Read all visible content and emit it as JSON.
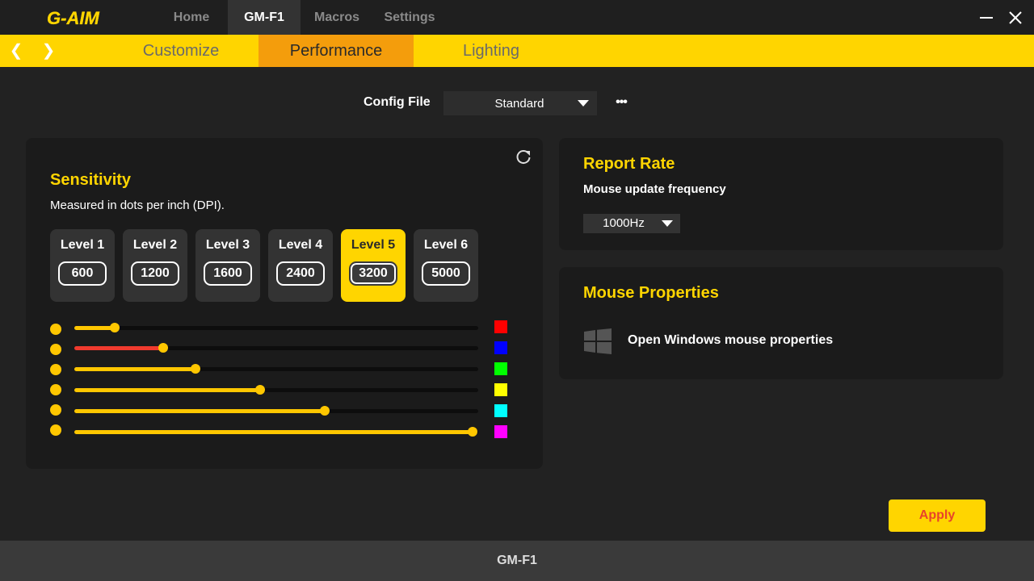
{
  "app": {
    "logo_text": "G-AIM"
  },
  "nav": {
    "tabs": [
      {
        "label": "Home",
        "active": false
      },
      {
        "label": "GM-F1",
        "active": true
      },
      {
        "label": "Macros",
        "active": false
      },
      {
        "label": "Settings",
        "active": false
      }
    ]
  },
  "window_controls": {
    "minimize_icon": "minimize-icon",
    "close_icon": "close-icon"
  },
  "subnav": {
    "back_icon": "chevron-left-icon",
    "forward_icon": "chevron-right-icon",
    "tabs": [
      {
        "label": "Customize",
        "active": false
      },
      {
        "label": "Performance",
        "active": true
      },
      {
        "label": "Lighting",
        "active": false
      }
    ]
  },
  "config": {
    "label": "Config File",
    "value": "Standard",
    "more_icon": "more-icon"
  },
  "sensitivity": {
    "title": "Sensitivity",
    "subtitle": "Measured in dots per inch (DPI).",
    "reset_icon": "refresh-icon",
    "levels": [
      {
        "name": "Level 1",
        "value": "600",
        "active": false
      },
      {
        "name": "Level 2",
        "value": "1200",
        "active": false
      },
      {
        "name": "Level 3",
        "value": "1600",
        "active": false
      },
      {
        "name": "Level 4",
        "value": "2400",
        "active": false
      },
      {
        "name": "Level 5",
        "value": "3200",
        "active": true
      },
      {
        "name": "Level 6",
        "value": "5000",
        "active": false
      }
    ],
    "sliders": [
      {
        "fraction": 0.1,
        "fill_color": "#ffc700",
        "swatch": "#ff0000"
      },
      {
        "fraction": 0.22,
        "fill_color": "#f03a2e",
        "swatch": "#0000ff"
      },
      {
        "fraction": 0.3,
        "fill_color": "#ffc700",
        "swatch": "#00ff00"
      },
      {
        "fraction": 0.46,
        "fill_color": "#ffc700",
        "swatch": "#ffff00"
      },
      {
        "fraction": 0.62,
        "fill_color": "#ffc700",
        "swatch": "#00ffff"
      },
      {
        "fraction": 0.985,
        "fill_color": "#ffc700",
        "swatch": "#ff00ff"
      }
    ]
  },
  "report_rate": {
    "title": "Report Rate",
    "subtitle": "Mouse update frequency",
    "value": "1000Hz"
  },
  "mouse_properties": {
    "title": "Mouse Properties",
    "link": "Open Windows mouse properties",
    "icon": "windows-icon"
  },
  "apply_label": "Apply",
  "footer": {
    "device": "GM-F1"
  },
  "colors": {
    "accent": "#ffd500",
    "active_tab": "#f49d0c",
    "background": "#222222"
  }
}
